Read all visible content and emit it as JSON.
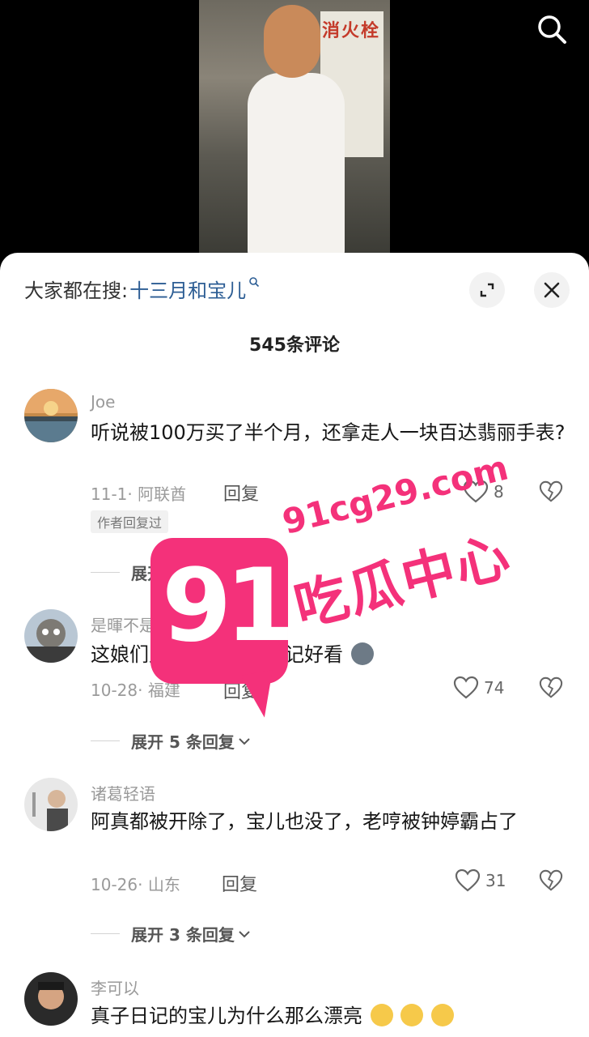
{
  "top": {
    "search_icon": "search-icon"
  },
  "video": {
    "sign_text": "消火栓"
  },
  "sheet": {
    "search_prefix": "大家都在搜:",
    "search_term": "十三月和宝儿",
    "expand_icon": "expand-icon",
    "close_icon": "close-icon",
    "comment_count": "545条评论"
  },
  "comments": [
    {
      "username": "Joe",
      "text": "听说被100万买了半个月，还拿走人一块百达翡丽手表?",
      "meta": "11-1· 阿联酋",
      "reply": "回复",
      "likes": "8",
      "badge": "作者回复过",
      "expand": "展开 8 条回复"
    },
    {
      "username": "是暉不是輝",
      "text": "这娘们儿只有在真子日记好看",
      "meta": "10-28· 福建",
      "reply": "回复",
      "likes": "74",
      "expand": "展开 5 条回复"
    },
    {
      "username": "诸葛轻语",
      "text": "阿真都被开除了，宝儿也没了，老哼被钟婷霸占了",
      "meta": "10-26· 山东",
      "reply": "回复",
      "likes": "31",
      "expand": "展开 3 条回复"
    },
    {
      "username": "李可以",
      "text": "真子日记的宝儿为什么那么漂亮"
    }
  ],
  "watermark": {
    "number": "91",
    "url": "91cg29.com",
    "name": "吃瓜中心"
  },
  "colors": {
    "accent_link": "#2c5d94",
    "watermark": "#f4317a"
  }
}
